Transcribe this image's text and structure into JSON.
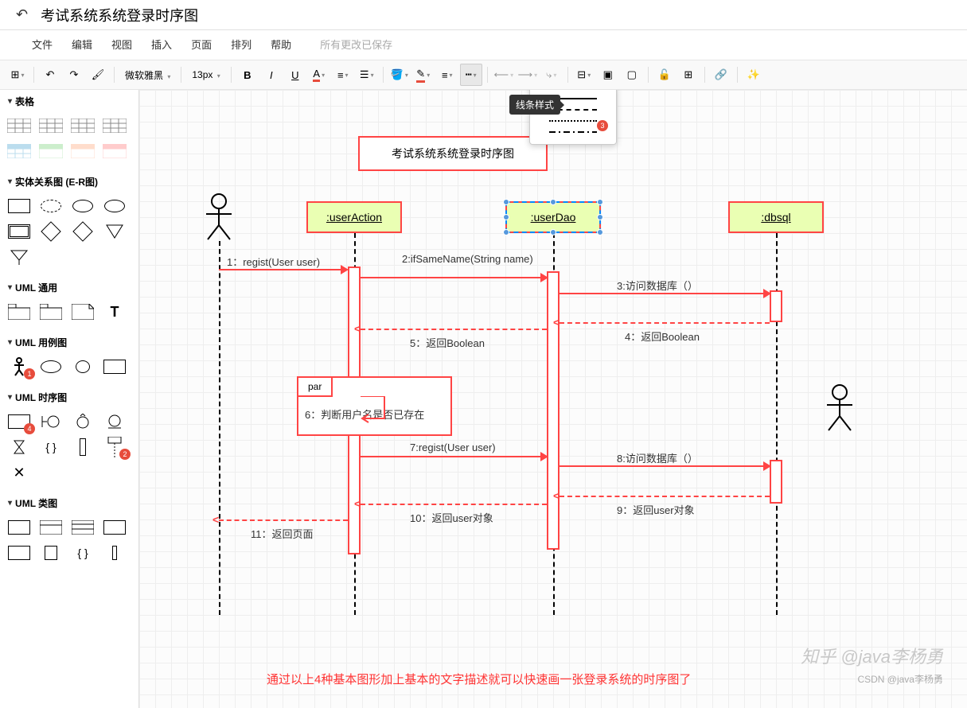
{
  "header": {
    "title": "考试系统系统登录时序图"
  },
  "menubar": {
    "items": [
      "文件",
      "编辑",
      "视图",
      "插入",
      "页面",
      "排列",
      "帮助"
    ],
    "autosave": "所有更改已保存"
  },
  "toolbar": {
    "font": "微软雅黑",
    "fontsize": "13px"
  },
  "tooltip": {
    "linestyle": "线条样式"
  },
  "popup_badge": "3",
  "sidebar": {
    "sections": {
      "tables": "表格",
      "er": "实体关系图 (E-R图)",
      "uml_general": "UML 通用",
      "uml_usecase": "UML 用例图",
      "uml_sequence": "UML 时序图",
      "uml_class": "UML 类图"
    },
    "badges": {
      "actor": "1",
      "seq1": "4",
      "seq2": "2"
    }
  },
  "diagram": {
    "title": "考试系统系统登录时序图",
    "lifelines": {
      "userAction": ":userAction",
      "userDao": ":userDao",
      "dbsql": ":dbsql"
    },
    "par_label": "par",
    "messages": {
      "m1": "1：regist(User user)",
      "m2": "2:ifSameName(String name)",
      "m3": "3:访问数据库（）",
      "m4": "4：返回Boolean",
      "m5": "5：返回Boolean",
      "m6": "6：判断用户名是否已存在",
      "m7": "7:regist(User user)",
      "m8": "8:访问数据库（）",
      "m9": "9：返回user对象",
      "m10": "10：返回user对象",
      "m11": "11：返回页面"
    },
    "caption": "通过以上4种基本图形加上基本的文字描述就可以快速画一张登录系统的时序图了"
  },
  "watermark": {
    "line1": "知乎 @java李杨勇",
    "line2": "CSDN @java李杨勇"
  }
}
